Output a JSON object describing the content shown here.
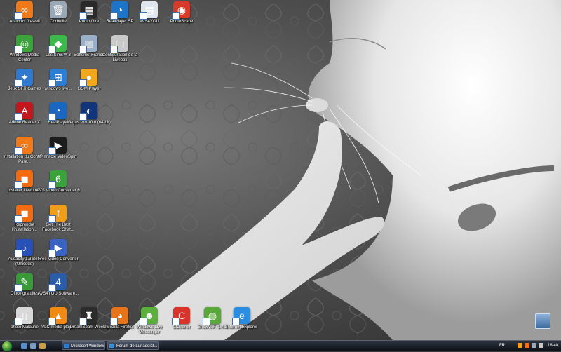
{
  "desktop": {
    "icons": [
      {
        "label": "Antivirus firewall",
        "color": "#f07a1a",
        "glyph": "∞"
      },
      {
        "label": "Corbeille",
        "color": "#9aa7b4",
        "glyph": "🗑"
      },
      {
        "label": "Photo filtre",
        "color": "#2a2a2a",
        "glyph": "▦"
      },
      {
        "label": "RealPlayer SP",
        "color": "#1d74c9",
        "glyph": "◔"
      },
      {
        "label": "AVS4YOU",
        "color": "#dfe6ee",
        "glyph": "▤"
      },
      {
        "label": "PhotoScape",
        "color": "#d83a2a",
        "glyph": "◉"
      },
      {
        "label": "Windows Media Center",
        "color": "#3aa33a",
        "glyph": "◎"
      },
      {
        "label": "Les Sims™ 3",
        "color": "#3db84a",
        "glyph": "◆"
      },
      {
        "label": "Softonic_France",
        "color": "#9ab0c8",
        "glyph": "▥"
      },
      {
        "label": "Configuration de la Livebox",
        "color": "#c9c9c9",
        "glyph": "▢"
      },
      {
        "label": "Jeux SFR Games",
        "color": "#2f79d0",
        "glyph": "✦"
      },
      {
        "label": "windows live...",
        "color": "#2b7ed3",
        "glyph": "⊞"
      },
      {
        "label": "GOM Player",
        "color": "#f2a81d",
        "glyph": "●"
      },
      {
        "label": "Adobe Reader X",
        "color": "#c4171c",
        "glyph": "A"
      },
      {
        "label": "RealPlayer",
        "color": "#1a66c2",
        "glyph": "◔"
      },
      {
        "label": "Vegas Pro 10.0 (64-bit)",
        "color": "#12357a",
        "glyph": "◐"
      },
      {
        "label": "Installation du Contrôle Pare...",
        "color": "#f07a1a",
        "glyph": "∞"
      },
      {
        "label": "Pinnacle VideoSpin",
        "color": "#1c1c1c",
        "glyph": "▶"
      },
      {
        "label": "Installer Livebox...",
        "color": "#f26b10",
        "glyph": "◼"
      },
      {
        "label": "AVS Video Converter 6",
        "color": "#39a23a",
        "glyph": "6"
      },
      {
        "label": "Reprendre l'installation...",
        "color": "#f26b10",
        "glyph": "◼"
      },
      {
        "label": "Get The Best Facebook Chat...",
        "color": "#f09d1a",
        "glyph": "f"
      },
      {
        "label": "Audacity 1.3 Beta (Unicode)",
        "color": "#2750b8",
        "glyph": "♪"
      },
      {
        "label": "Free Video Converter",
        "color": "#3b63c2",
        "glyph": "▶"
      },
      {
        "label": "Office gratuites",
        "color": "#3a9a3a",
        "glyph": "✎"
      },
      {
        "label": "AVS4YOU Software...",
        "color": "#2b5ca8",
        "glyph": "4"
      },
      {
        "label": "photo Malaurie",
        "color": "#d8d8d8",
        "glyph": "▯"
      },
      {
        "label": "VLC media player",
        "color": "#f18a12",
        "glyph": "▲"
      },
      {
        "label": "DreamSpark Weekly",
        "color": "#2c2c2c",
        "glyph": "♜"
      },
      {
        "label": "Mozilla Firefox",
        "color": "#e8741a",
        "glyph": "◕"
      },
      {
        "label": "Windows Live Messenger",
        "color": "#5ab03a",
        "glyph": "☻"
      },
      {
        "label": "CCleaner",
        "color": "#d8342a",
        "glyph": "C"
      },
      {
        "label": "ShowWiFi 1.4.3",
        "color": "#5aa83a",
        "glyph": "◍"
      },
      {
        "label": "Internet Explorer",
        "color": "#2a8de0",
        "glyph": "e"
      }
    ]
  },
  "taskbar": {
    "quicklaunch": [
      {
        "name": "show-desktop",
        "color": "#5a8cc8"
      },
      {
        "name": "switch-windows",
        "color": "#7a9ac4"
      },
      {
        "name": "media",
        "color": "#c8a040"
      }
    ],
    "buttons": [
      {
        "label": "Microsoft Windows",
        "color": "#2b7ed3"
      },
      {
        "label": "Forum de Lunaddict...",
        "color": "#3a90d8"
      }
    ],
    "tray": {
      "language": "FR",
      "clock": "18:40",
      "icons": [
        {
          "name": "tray-shield",
          "color": "#f0a020"
        },
        {
          "name": "tray-orange",
          "color": "#f26b10"
        },
        {
          "name": "tray-network",
          "color": "#9aaabb"
        },
        {
          "name": "tray-volume",
          "color": "#c8c8c8"
        }
      ]
    }
  }
}
